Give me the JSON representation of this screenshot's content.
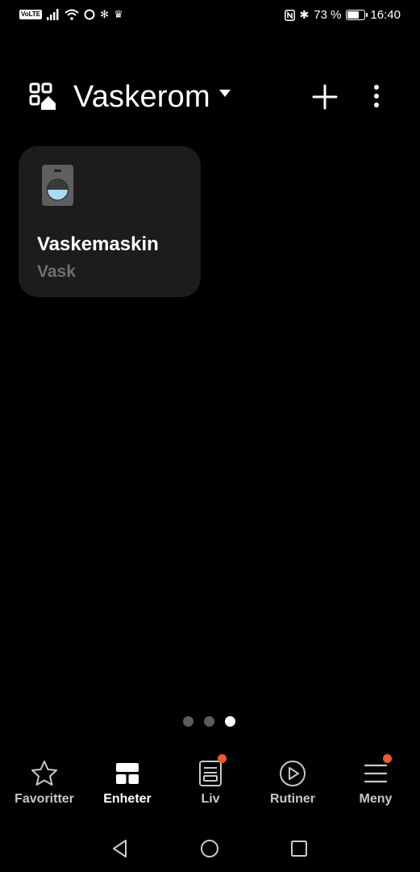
{
  "status_bar": {
    "volte": "VoLTE",
    "battery_percent": "73 %",
    "battery_level": 0.73,
    "time": "16:40"
  },
  "header": {
    "room_name": "Vaskerom"
  },
  "device_card": {
    "name": "Vaskemaskin",
    "status": "Vask",
    "icon": "washing-machine-icon"
  },
  "pager": {
    "count": 3,
    "active_index": 2
  },
  "bottom_nav": {
    "items": [
      {
        "label": "Favoritter",
        "icon": "star-icon",
        "active": false,
        "badge": false
      },
      {
        "label": "Enheter",
        "icon": "devices-grid-icon",
        "active": true,
        "badge": false
      },
      {
        "label": "Liv",
        "icon": "life-icon",
        "active": false,
        "badge": true
      },
      {
        "label": "Rutiner",
        "icon": "play-circle-icon",
        "active": false,
        "badge": false
      },
      {
        "label": "Meny",
        "icon": "menu-icon",
        "active": false,
        "badge": true
      }
    ]
  },
  "colors": {
    "background": "#000000",
    "card": "#1c1c1c",
    "badge": "#f0592a",
    "washer_water": "#a7dcf5"
  }
}
